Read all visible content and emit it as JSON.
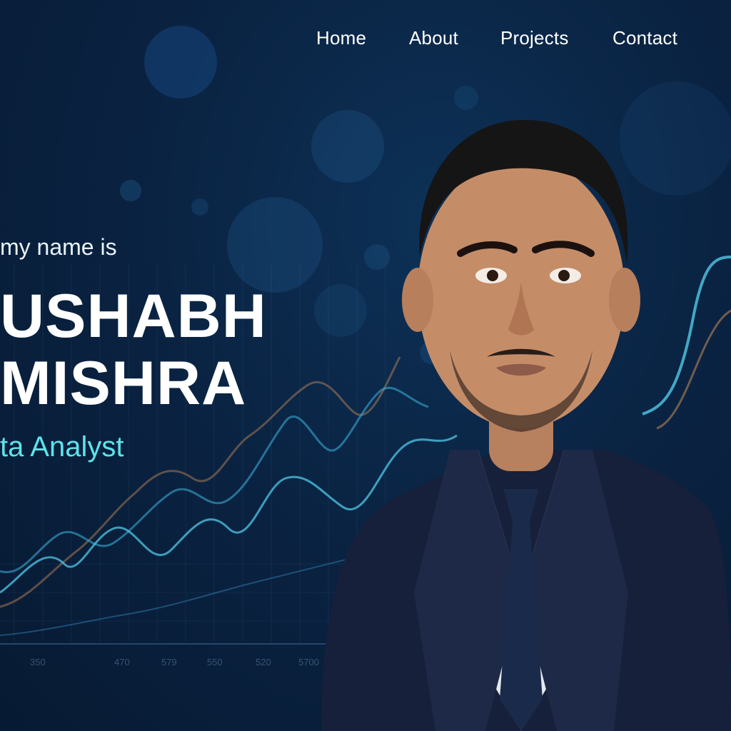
{
  "nav": {
    "items": [
      {
        "label": "Home"
      },
      {
        "label": "About"
      },
      {
        "label": "Projects"
      },
      {
        "label": "Contact"
      }
    ]
  },
  "hero": {
    "intro": "my name is",
    "name_line_1": "USHABH",
    "name_line_2": "MISHRA",
    "role": "ta Analyst"
  },
  "background_chart": {
    "tick_labels": [
      "350",
      "470",
      "579",
      "550",
      "520",
      "5700"
    ]
  },
  "colors": {
    "background": "#0a2342",
    "accent": "#5fe3ea",
    "text": "#ffffff"
  }
}
